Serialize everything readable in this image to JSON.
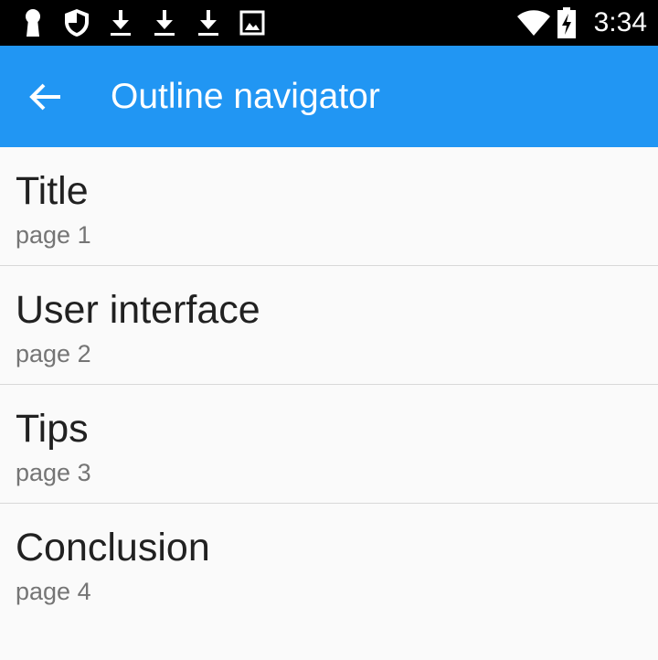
{
  "status_bar": {
    "time": "3:34",
    "icons": [
      "keyhole-icon",
      "shield-icon",
      "download-icon",
      "download-icon",
      "download-icon",
      "image-icon",
      "wifi-icon",
      "battery-charging-icon"
    ]
  },
  "toolbar": {
    "title": "Outline navigator",
    "back_icon": "arrow-back-icon",
    "background": "#2196f3"
  },
  "outline": {
    "items": [
      {
        "title": "Title",
        "page": "page 1"
      },
      {
        "title": "User interface",
        "page": "page 2"
      },
      {
        "title": "Tips",
        "page": "page 3"
      },
      {
        "title": "Conclusion",
        "page": "page 4"
      }
    ]
  }
}
